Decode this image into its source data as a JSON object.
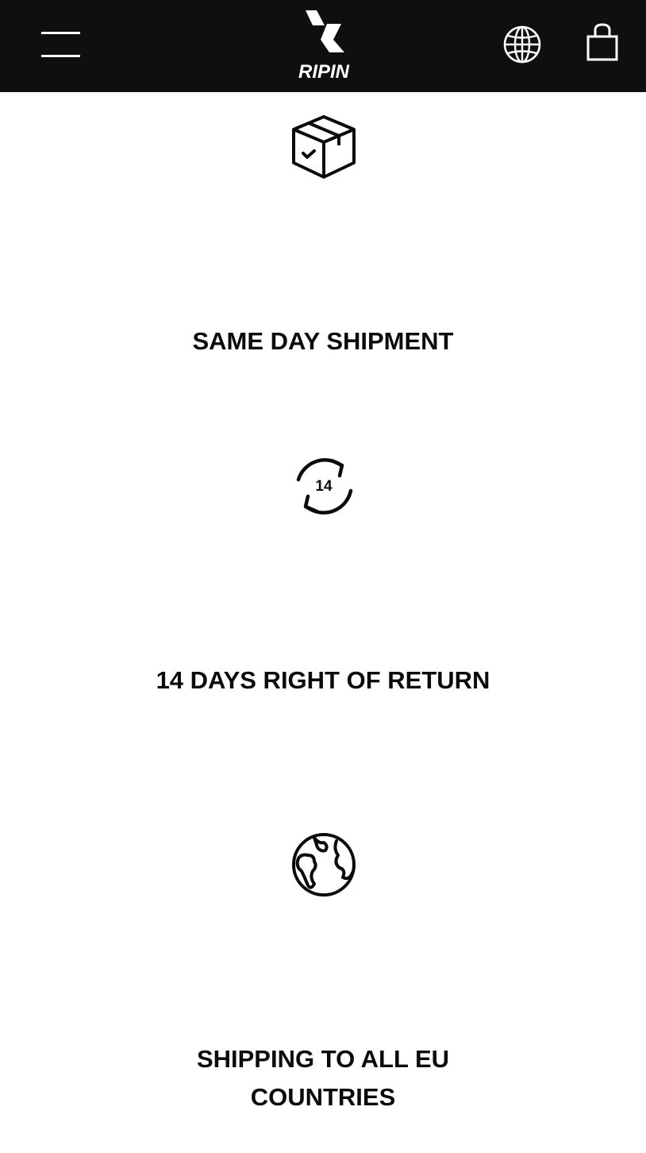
{
  "header": {
    "menu_icon": "hamburger-menu-icon",
    "brand": "RIPIN",
    "language_icon": "globe-icon",
    "cart_icon": "shopping-bag-icon",
    "background": "#0f0f0f",
    "foreground": "#ffffff"
  },
  "features": [
    {
      "icon": "box-check-icon",
      "title": "SAME DAY SHIPMENT"
    },
    {
      "icon": "return-14-days-icon",
      "icon_text": "14",
      "title": "14 DAYS RIGHT OF RETURN"
    },
    {
      "icon": "earth-icon",
      "title": "SHIPPING TO ALL EU COUNTRIES"
    }
  ]
}
